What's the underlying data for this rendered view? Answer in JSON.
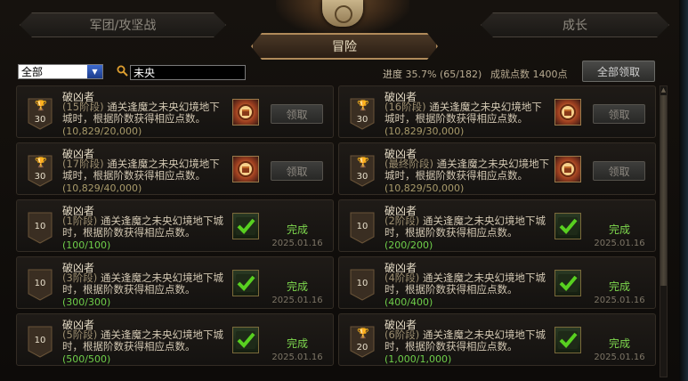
{
  "tabs": {
    "left": "军团/攻坚战",
    "active": "冒险",
    "right": "成长"
  },
  "filter": {
    "select_value": "全部",
    "search_value": "未央"
  },
  "progress": {
    "label": "进度",
    "percent": "35.7%",
    "fraction": "(65/182)"
  },
  "points": {
    "label": "成就点数",
    "value": "1400点"
  },
  "claim_all_label": "全部领取",
  "cards": [
    {
      "title": "破凶者",
      "stage": "(15阶段)",
      "desc": "通关逢魔之未央幻境地下城时，根据阶数获得相应点数。",
      "count": "(10,829/20,000)",
      "badge": "30",
      "trophy": true,
      "state": "claim",
      "button": "领取"
    },
    {
      "title": "破凶者",
      "stage": "(16阶段)",
      "desc": "通关逢魔之未央幻境地下城时，根据阶数获得相应点数。",
      "count": "(10,829/30,000)",
      "badge": "30",
      "trophy": true,
      "state": "claim",
      "button": "领取"
    },
    {
      "title": "破凶者",
      "stage": "(17阶段)",
      "desc": "通关逢魔之未央幻境地下城时，根据阶数获得相应点数。",
      "count": "(10,829/40,000)",
      "badge": "30",
      "trophy": true,
      "state": "claim",
      "button": "领取"
    },
    {
      "title": "破凶者",
      "stage": "(最终阶段)",
      "desc": "通关逢魔之未央幻境地下城时，根据阶数获得相应点数。",
      "count": "(10,829/50,000)",
      "badge": "30",
      "trophy": true,
      "state": "claim",
      "button": "领取"
    },
    {
      "title": "破凶者",
      "stage": "(1阶段)",
      "desc": "通关逢魔之未央幻境地下城时，根据阶数获得相应点数。",
      "count": "(100/100)",
      "badge": "10",
      "trophy": false,
      "state": "done",
      "status": "完成",
      "date": "2025.01.16"
    },
    {
      "title": "破凶者",
      "stage": "(2阶段)",
      "desc": "通关逢魔之未央幻境地下城时，根据阶数获得相应点数。",
      "count": "(200/200)",
      "badge": "10",
      "trophy": false,
      "state": "done",
      "status": "完成",
      "date": "2025.01.16"
    },
    {
      "title": "破凶者",
      "stage": "(3阶段)",
      "desc": "通关逢魔之未央幻境地下城时，根据阶数获得相应点数。",
      "count": "(300/300)",
      "badge": "10",
      "trophy": false,
      "state": "done",
      "status": "完成",
      "date": "2025.01.16"
    },
    {
      "title": "破凶者",
      "stage": "(4阶段)",
      "desc": "通关逢魔之未央幻境地下城时，根据阶数获得相应点数。",
      "count": "(400/400)",
      "badge": "10",
      "trophy": false,
      "state": "done",
      "status": "完成",
      "date": "2025.01.16"
    },
    {
      "title": "破凶者",
      "stage": "(5阶段)",
      "desc": "通关逢魔之未央幻境地下城时，根据阶数获得相应点数。",
      "count": "(500/500)",
      "badge": "10",
      "trophy": false,
      "state": "done",
      "status": "完成",
      "date": "2025.01.16"
    },
    {
      "title": "破凶者",
      "stage": "(6阶段)",
      "desc": "通关逢魔之未央幻境地下城时，根据阶数获得相应点数。",
      "count": "(1,000/1,000)",
      "badge": "20",
      "trophy": true,
      "state": "done",
      "status": "完成",
      "date": "2025.01.16"
    }
  ],
  "colors": {
    "done_green": "#7ed84e",
    "gold_border": "#b08a5a"
  }
}
